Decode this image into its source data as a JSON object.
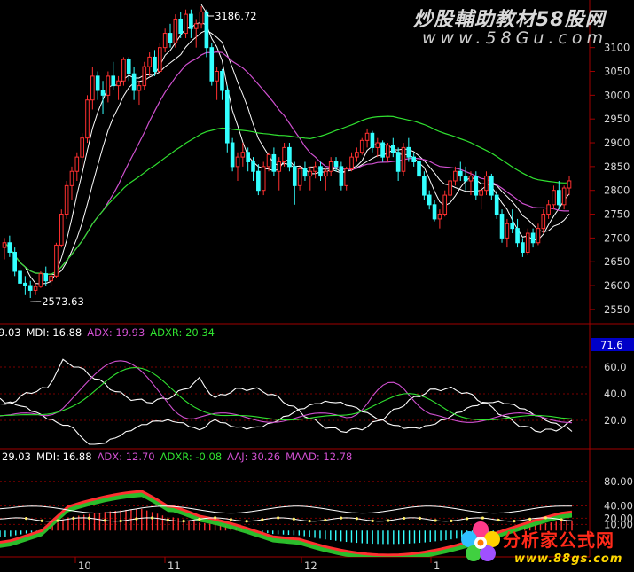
{
  "watermark": {
    "title": "炒股輔助教材58股网",
    "url": "www.58Gu.com"
  },
  "logo": {
    "name": "分析家公式网",
    "url": "www.88gs.com"
  },
  "colors": {
    "up": "#ff3030",
    "down": "#33ffff",
    "ma5": "#ffffff",
    "ma10": "#ffffff",
    "ma20": "#d050d0",
    "ma60": "#30e030",
    "grid": "#7a0000",
    "axis": "#a00000"
  },
  "chart_data": [
    {
      "type": "candlestick",
      "panel": "price",
      "ylim": [
        2520,
        3200
      ],
      "y_ticks": [
        2550,
        2600,
        2650,
        2700,
        2750,
        2800,
        2850,
        2900,
        2950,
        3000,
        3050,
        3100
      ],
      "annotations": [
        {
          "label": "3186.72",
          "value": 3186.72,
          "index": 38
        },
        {
          "label": "2573.63",
          "value": 2573.63,
          "index": 5
        }
      ],
      "ohlc": [
        [
          2680,
          2700,
          2655,
          2690
        ],
        [
          2690,
          2705,
          2660,
          2670
        ],
        [
          2670,
          2680,
          2620,
          2630
        ],
        [
          2630,
          2645,
          2590,
          2605
        ],
        [
          2605,
          2620,
          2580,
          2600
        ],
        [
          2600,
          2610,
          2574,
          2590
        ],
        [
          2590,
          2605,
          2580,
          2598
        ],
        [
          2598,
          2630,
          2595,
          2625
        ],
        [
          2625,
          2640,
          2600,
          2610
        ],
        [
          2610,
          2625,
          2600,
          2620
        ],
        [
          2620,
          2690,
          2615,
          2685
        ],
        [
          2685,
          2760,
          2680,
          2750
        ],
        [
          2750,
          2820,
          2740,
          2810
        ],
        [
          2810,
          2850,
          2780,
          2840
        ],
        [
          2840,
          2880,
          2820,
          2870
        ],
        [
          2870,
          2920,
          2850,
          2910
        ],
        [
          2910,
          3000,
          2900,
          2990
        ],
        [
          2990,
          3060,
          2970,
          3040
        ],
        [
          3040,
          3050,
          2990,
          3010
        ],
        [
          3010,
          3030,
          2960,
          3000
        ],
        [
          3000,
          3050,
          2985,
          3040
        ],
        [
          3040,
          3070,
          3010,
          3020
        ],
        [
          3020,
          3040,
          2990,
          3030
        ],
        [
          3030,
          3080,
          3020,
          3075
        ],
        [
          3075,
          3080,
          3030,
          3045
        ],
        [
          3045,
          3060,
          2990,
          3010
        ],
        [
          3010,
          3030,
          2980,
          3020
        ],
        [
          3020,
          3070,
          3010,
          3060
        ],
        [
          3060,
          3090,
          3040,
          3080
        ],
        [
          3080,
          3095,
          3040,
          3050
        ],
        [
          3050,
          3110,
          3045,
          3100
        ],
        [
          3100,
          3140,
          3090,
          3130
        ],
        [
          3130,
          3150,
          3100,
          3110
        ],
        [
          3110,
          3170,
          3100,
          3160
        ],
        [
          3160,
          3175,
          3120,
          3130
        ],
        [
          3130,
          3180,
          3120,
          3170
        ],
        [
          3170,
          3180,
          3120,
          3140
        ],
        [
          3140,
          3160,
          3100,
          3150
        ],
        [
          3150,
          3187,
          3140,
          3175
        ],
        [
          3175,
          3180,
          3080,
          3100
        ],
        [
          3100,
          3110,
          3020,
          3030
        ],
        [
          3030,
          3060,
          2990,
          3050
        ],
        [
          3050,
          3055,
          2990,
          3010
        ],
        [
          3010,
          3020,
          2880,
          2900
        ],
        [
          2900,
          2910,
          2840,
          2850
        ],
        [
          2850,
          2880,
          2820,
          2870
        ],
        [
          2870,
          2900,
          2850,
          2880
        ],
        [
          2880,
          2890,
          2840,
          2860
        ],
        [
          2860,
          2870,
          2820,
          2840
        ],
        [
          2840,
          2855,
          2790,
          2800
        ],
        [
          2800,
          2860,
          2790,
          2850
        ],
        [
          2850,
          2880,
          2840,
          2875
        ],
        [
          2875,
          2890,
          2830,
          2840
        ],
        [
          2840,
          2870,
          2800,
          2860
        ],
        [
          2860,
          2900,
          2850,
          2890
        ],
        [
          2890,
          2900,
          2840,
          2850
        ],
        [
          2850,
          2860,
          2770,
          2810
        ],
        [
          2810,
          2850,
          2800,
          2845
        ],
        [
          2845,
          2860,
          2820,
          2830
        ],
        [
          2830,
          2850,
          2800,
          2840
        ],
        [
          2840,
          2860,
          2825,
          2850
        ],
        [
          2850,
          2860,
          2820,
          2830
        ],
        [
          2830,
          2845,
          2800,
          2840
        ],
        [
          2840,
          2870,
          2830,
          2860
        ],
        [
          2860,
          2870,
          2840,
          2850
        ],
        [
          2850,
          2860,
          2800,
          2810
        ],
        [
          2810,
          2850,
          2800,
          2845
        ],
        [
          2845,
          2880,
          2840,
          2870
        ],
        [
          2870,
          2890,
          2860,
          2880
        ],
        [
          2880,
          2910,
          2875,
          2905
        ],
        [
          2905,
          2930,
          2890,
          2920
        ],
        [
          2920,
          2925,
          2880,
          2890
        ],
        [
          2890,
          2910,
          2870,
          2900
        ],
        [
          2900,
          2905,
          2860,
          2870
        ],
        [
          2870,
          2900,
          2860,
          2895
        ],
        [
          2895,
          2910,
          2870,
          2880
        ],
        [
          2880,
          2890,
          2820,
          2840
        ],
        [
          2840,
          2900,
          2830,
          2890
        ],
        [
          2890,
          2910,
          2860,
          2870
        ],
        [
          2870,
          2880,
          2850,
          2860
        ],
        [
          2860,
          2870,
          2820,
          2830
        ],
        [
          2830,
          2840,
          2780,
          2790
        ],
        [
          2790,
          2800,
          2760,
          2770
        ],
        [
          2770,
          2780,
          2735,
          2740
        ],
        [
          2740,
          2760,
          2720,
          2750
        ],
        [
          2750,
          2800,
          2745,
          2790
        ],
        [
          2790,
          2830,
          2780,
          2820
        ],
        [
          2820,
          2850,
          2810,
          2840
        ],
        [
          2840,
          2860,
          2820,
          2830
        ],
        [
          2830,
          2850,
          2800,
          2820
        ],
        [
          2820,
          2840,
          2790,
          2830
        ],
        [
          2830,
          2840,
          2780,
          2790
        ],
        [
          2790,
          2810,
          2760,
          2800
        ],
        [
          2800,
          2840,
          2790,
          2830
        ],
        [
          2830,
          2835,
          2780,
          2790
        ],
        [
          2790,
          2800,
          2740,
          2750
        ],
        [
          2750,
          2760,
          2690,
          2700
        ],
        [
          2700,
          2740,
          2680,
          2730
        ],
        [
          2730,
          2760,
          2710,
          2720
        ],
        [
          2720,
          2740,
          2680,
          2690
        ],
        [
          2690,
          2700,
          2660,
          2670
        ],
        [
          2670,
          2720,
          2665,
          2710
        ],
        [
          2710,
          2720,
          2680,
          2690
        ],
        [
          2690,
          2730,
          2685,
          2720
        ],
        [
          2720,
          2760,
          2710,
          2750
        ],
        [
          2750,
          2780,
          2740,
          2770
        ],
        [
          2770,
          2810,
          2760,
          2800
        ],
        [
          2800,
          2820,
          2760,
          2770
        ],
        [
          2770,
          2810,
          2760,
          2805
        ],
        [
          2805,
          2830,
          2790,
          2820
        ]
      ]
    },
    {
      "type": "line",
      "panel": "DMI",
      "legend": [
        {
          "label": "9.03",
          "color": "#ffffff"
        },
        {
          "label": "MDI: 16.88",
          "color": "#ffffff"
        },
        {
          "label": "ADX: 19.93",
          "color": "#d050d0"
        },
        {
          "label": "ADXR: 20.34",
          "color": "#30e030"
        }
      ],
      "ylim": [
        0,
        80
      ],
      "y_ticks": [
        20.0,
        40.0,
        60.0
      ],
      "highlight": "71.6"
    },
    {
      "type": "line",
      "panel": "DMI-AAJ",
      "legend": [
        {
          "label": "29.03",
          "color": "#ffffff"
        },
        {
          "label": "MDI: 16.88",
          "color": "#ffffff"
        },
        {
          "label": "ADX: 12.70",
          "color": "#d050d0"
        },
        {
          "label": "ADXR: -0.08",
          "color": "#30e030"
        },
        {
          "label": "AAJ: 30.26",
          "color": "#d050d0"
        },
        {
          "label": "MAAD: 12.78",
          "color": "#d050d0"
        }
      ],
      "ylim": [
        -40,
        110
      ],
      "y_ticks": [
        80.0,
        40.0,
        20.0,
        10.0
      ]
    }
  ],
  "x_axis": {
    "labels": [
      "10",
      "11",
      "12",
      "1"
    ]
  }
}
